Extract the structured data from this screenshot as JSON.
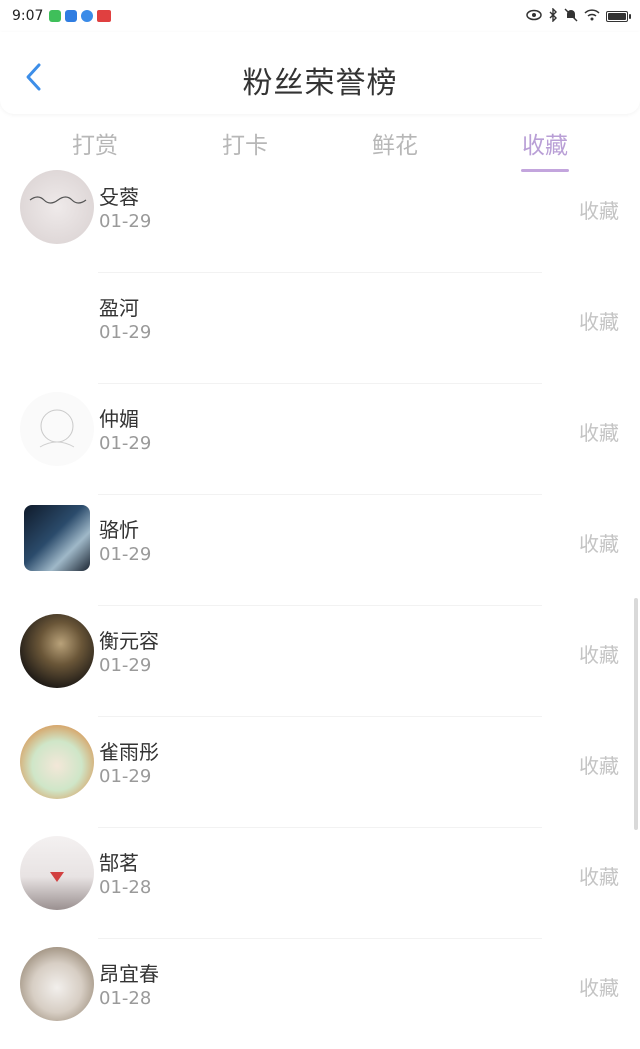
{
  "status_bar": {
    "time": "9:07",
    "app_icons": [
      {
        "name": "wechat-icon",
        "color": "#3fbf5a"
      },
      {
        "name": "app-blue-icon",
        "color": "#2f7de1"
      },
      {
        "name": "browser-icon",
        "color": "#3a8be8"
      },
      {
        "name": "app-red-icon",
        "color": "#e04040"
      }
    ],
    "battery_level": 0.9
  },
  "header": {
    "title": "粉丝荣誉榜",
    "back_icon": "chevron-left-icon"
  },
  "tabs": [
    {
      "label": "打赏",
      "active": false
    },
    {
      "label": "打卡",
      "active": false
    },
    {
      "label": "鲜花",
      "active": false
    },
    {
      "label": "收藏",
      "active": true
    }
  ],
  "colors": {
    "accent": "#c3a5dd",
    "back": "#3d8ee8",
    "muted": "#c4c4c4"
  },
  "fans": [
    {
      "name": "殳蓉",
      "date": "01-29",
      "action": "收藏"
    },
    {
      "name": "盈河",
      "date": "01-29",
      "action": "收藏"
    },
    {
      "name": "仲媚",
      "date": "01-29",
      "action": "收藏"
    },
    {
      "name": "骆忻",
      "date": "01-29",
      "action": "收藏"
    },
    {
      "name": "衡元容",
      "date": "01-29",
      "action": "收藏"
    },
    {
      "name": "雀雨彤",
      "date": "01-29",
      "action": "收藏"
    },
    {
      "name": "郜茗",
      "date": "01-28",
      "action": "收藏"
    },
    {
      "name": "昂宜春",
      "date": "01-28",
      "action": "收藏"
    }
  ]
}
